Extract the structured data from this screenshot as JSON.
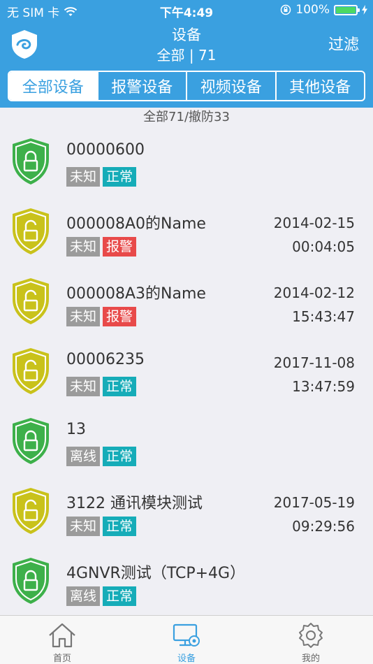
{
  "status_bar": {
    "carrier": "无 SIM 卡",
    "time": "下午4:49",
    "battery": "100%",
    "battery_level": 1.0
  },
  "nav": {
    "title": "设备",
    "subtitle": "全部 | 71",
    "filter": "过滤"
  },
  "tabs": [
    {
      "label": "全部设备",
      "active": true
    },
    {
      "label": "报警设备",
      "active": false
    },
    {
      "label": "视频设备",
      "active": false
    },
    {
      "label": "其他设备",
      "active": false
    }
  ],
  "summary": "全部71/撤防33",
  "devices": [
    {
      "name": "00000600",
      "status": "未知",
      "state": "正常",
      "state_color": "teal",
      "date": "",
      "clock": "",
      "shield": "green"
    },
    {
      "name": "000008A0的Name",
      "status": "未知",
      "state": "报警",
      "state_color": "red",
      "date": "2014-02-15",
      "clock": "00:04:05",
      "shield": "yellow"
    },
    {
      "name": "000008A3的Name",
      "status": "未知",
      "state": "报警",
      "state_color": "red",
      "date": "2014-02-12",
      "clock": "15:43:47",
      "shield": "yellow"
    },
    {
      "name": "00006235",
      "status": "未知",
      "state": "正常",
      "state_color": "teal",
      "date": "2017-11-08",
      "clock": "13:47:59",
      "shield": "yellow"
    },
    {
      "name": "13",
      "status": "离线",
      "state": "正常",
      "state_color": "teal",
      "date": "",
      "clock": "",
      "shield": "green"
    },
    {
      "name": "3122 通讯模块测试",
      "status": "未知",
      "state": "正常",
      "state_color": "teal",
      "date": "2017-05-19",
      "clock": "09:29:56",
      "shield": "yellow"
    },
    {
      "name": "4GNVR测试（TCP+4G）",
      "status": "离线",
      "state": "正常",
      "state_color": "teal",
      "date": "",
      "clock": "",
      "shield": "green"
    }
  ],
  "tabbar": [
    {
      "label": "首页",
      "icon": "home-icon",
      "active": false
    },
    {
      "label": "设备",
      "icon": "device-monitor-icon",
      "active": true
    },
    {
      "label": "我的",
      "icon": "gear-icon",
      "active": false
    }
  ],
  "colors": {
    "primary": "#3aa0e0",
    "shield_green": "#3db04a",
    "shield_yellow": "#c9c21b",
    "tag_gray": "#9b9b9b",
    "tag_teal": "#16acb8",
    "tag_red": "#e84a4a"
  }
}
